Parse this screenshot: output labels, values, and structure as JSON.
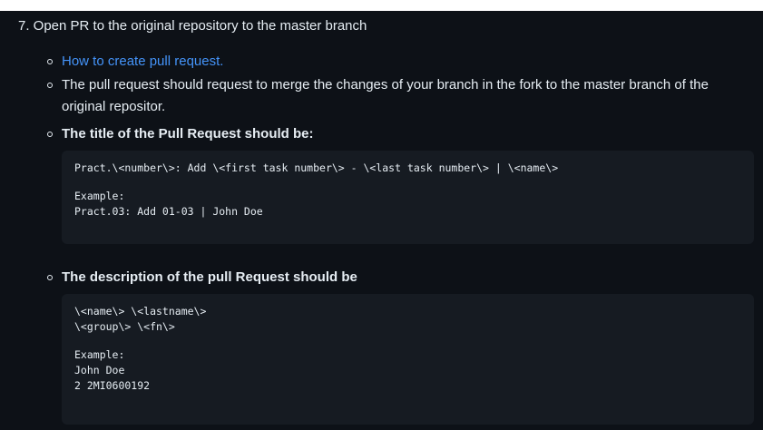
{
  "step": {
    "heading": "7. Open PR to the original repository to the master branch"
  },
  "items": [
    {
      "text": "How to create pull request."
    },
    {
      "text": "The pull request should request to merge the changes of your branch in the fork to the master branch of the original repositor."
    },
    {
      "text": "The title of the Pull Request should be:"
    },
    {
      "text": "The description of the pull Request should be"
    }
  ],
  "title_code": {
    "template": "Pract.\\<number\\>: Add \\<first task number\\> - \\<last task number\\> | \\<name\\>",
    "example_label": "Example:",
    "example_value": "Pract.03: Add 01-03 | John Doe"
  },
  "description_code": {
    "line1": "\\<name\\> \\<lastname\\>",
    "line2": "\\<group\\> \\<fn\\>",
    "example_label": "Example:",
    "example_name": "John Doe",
    "example_id": "2 2MI0600192"
  },
  "colors": {
    "background": "#0d1117",
    "code_background": "#161b22",
    "link": "#4493f8",
    "text": "#e6edf3"
  }
}
